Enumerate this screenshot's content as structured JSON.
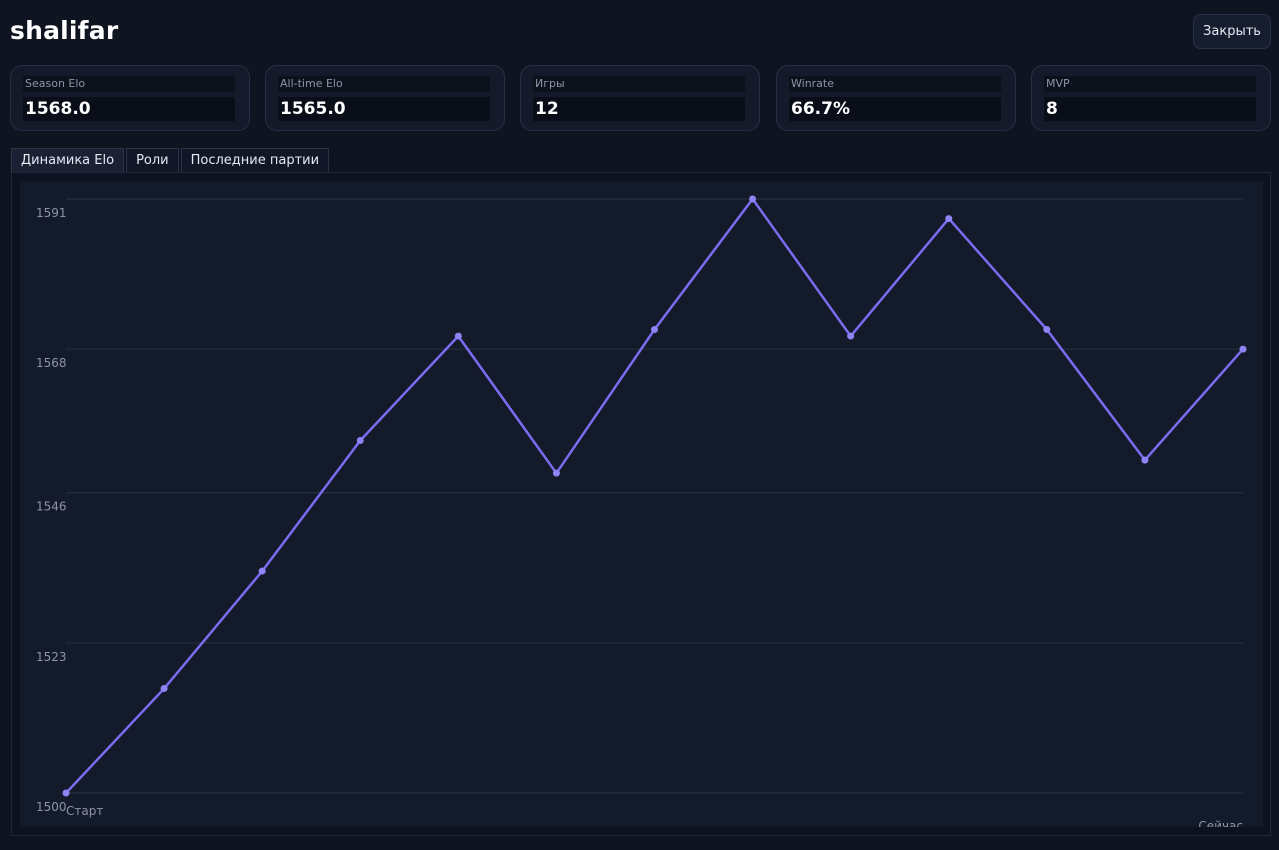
{
  "header": {
    "player_name": "shalifar",
    "close_label": "Закрыть"
  },
  "stats": [
    {
      "label": "Season Elo",
      "value": "1568.0"
    },
    {
      "label": "All-time Elo",
      "value": "1565.0"
    },
    {
      "label": "Игры",
      "value": "12"
    },
    {
      "label": "Winrate",
      "value": "66.7%"
    },
    {
      "label": "MVP",
      "value": "8"
    }
  ],
  "tabs": [
    {
      "label": "Динамика Elo",
      "active": true
    },
    {
      "label": "Роли",
      "active": false
    },
    {
      "label": "Последние партии",
      "active": false
    }
  ],
  "colors": {
    "line": "#7b6cf0",
    "point": "#8f83f5",
    "grid": "#273246"
  },
  "chart_data": {
    "type": "line",
    "x_start_label": "Старт",
    "x_end_label": "Сейчас",
    "yticks": [
      1500,
      1523,
      1546,
      1568,
      1591
    ],
    "ylim": [
      1500,
      1591
    ],
    "grid": true,
    "series": [
      {
        "values": [
          1500,
          1516,
          1534,
          1554,
          1570,
          1549,
          1571,
          1591,
          1570,
          1588,
          1571,
          1551,
          1568
        ]
      }
    ]
  }
}
